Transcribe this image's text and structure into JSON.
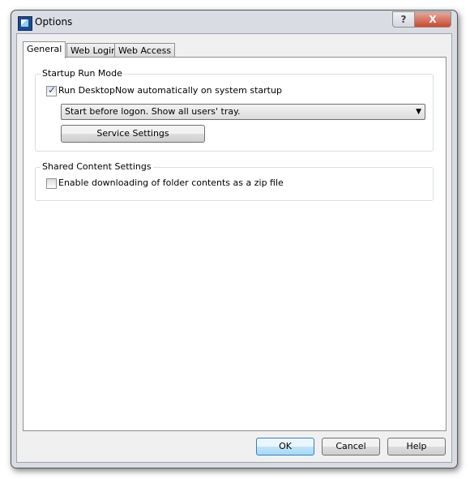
{
  "window": {
    "title": "Options",
    "help_label": "?",
    "close_label": "X"
  },
  "tabs": [
    {
      "label": "General",
      "active": true
    },
    {
      "label": "Web Login"
    },
    {
      "label": "Web Access"
    }
  ],
  "startup": {
    "group_label": "Startup Run Mode",
    "checkbox_label": "Run DesktopNow automatically on system startup",
    "checked": true,
    "mode_value": "Start before logon. Show all users' tray.",
    "service_button": "Service Settings"
  },
  "shared": {
    "group_label": "Shared Content Settings",
    "checkbox_label": "Enable downloading of folder contents as a zip file",
    "checked": false
  },
  "buttons": {
    "ok": "OK",
    "cancel": "Cancel",
    "help": "Help"
  }
}
